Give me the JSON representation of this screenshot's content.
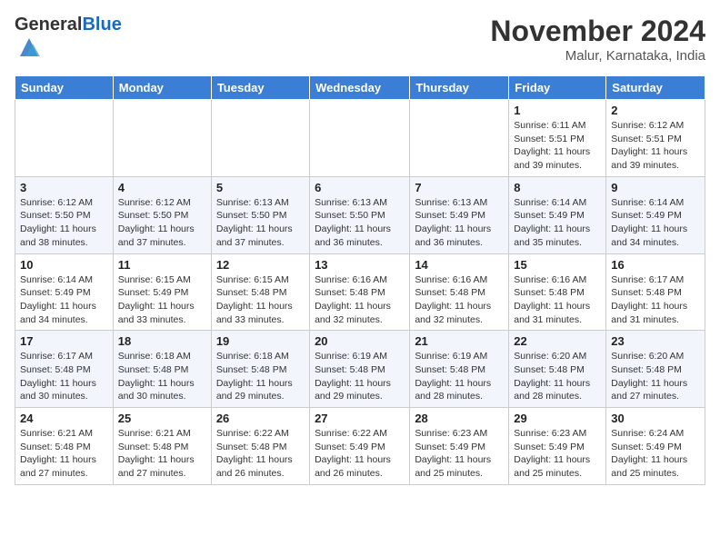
{
  "header": {
    "logo_general": "General",
    "logo_blue": "Blue",
    "month_title": "November 2024",
    "location": "Malur, Karnataka, India"
  },
  "weekdays": [
    "Sunday",
    "Monday",
    "Tuesday",
    "Wednesday",
    "Thursday",
    "Friday",
    "Saturday"
  ],
  "weeks": [
    [
      {
        "day": "",
        "info": ""
      },
      {
        "day": "",
        "info": ""
      },
      {
        "day": "",
        "info": ""
      },
      {
        "day": "",
        "info": ""
      },
      {
        "day": "",
        "info": ""
      },
      {
        "day": "1",
        "info": "Sunrise: 6:11 AM\nSunset: 5:51 PM\nDaylight: 11 hours and 39 minutes."
      },
      {
        "day": "2",
        "info": "Sunrise: 6:12 AM\nSunset: 5:51 PM\nDaylight: 11 hours and 39 minutes."
      }
    ],
    [
      {
        "day": "3",
        "info": "Sunrise: 6:12 AM\nSunset: 5:50 PM\nDaylight: 11 hours and 38 minutes."
      },
      {
        "day": "4",
        "info": "Sunrise: 6:12 AM\nSunset: 5:50 PM\nDaylight: 11 hours and 37 minutes."
      },
      {
        "day": "5",
        "info": "Sunrise: 6:13 AM\nSunset: 5:50 PM\nDaylight: 11 hours and 37 minutes."
      },
      {
        "day": "6",
        "info": "Sunrise: 6:13 AM\nSunset: 5:50 PM\nDaylight: 11 hours and 36 minutes."
      },
      {
        "day": "7",
        "info": "Sunrise: 6:13 AM\nSunset: 5:49 PM\nDaylight: 11 hours and 36 minutes."
      },
      {
        "day": "8",
        "info": "Sunrise: 6:14 AM\nSunset: 5:49 PM\nDaylight: 11 hours and 35 minutes."
      },
      {
        "day": "9",
        "info": "Sunrise: 6:14 AM\nSunset: 5:49 PM\nDaylight: 11 hours and 34 minutes."
      }
    ],
    [
      {
        "day": "10",
        "info": "Sunrise: 6:14 AM\nSunset: 5:49 PM\nDaylight: 11 hours and 34 minutes."
      },
      {
        "day": "11",
        "info": "Sunrise: 6:15 AM\nSunset: 5:49 PM\nDaylight: 11 hours and 33 minutes."
      },
      {
        "day": "12",
        "info": "Sunrise: 6:15 AM\nSunset: 5:48 PM\nDaylight: 11 hours and 33 minutes."
      },
      {
        "day": "13",
        "info": "Sunrise: 6:16 AM\nSunset: 5:48 PM\nDaylight: 11 hours and 32 minutes."
      },
      {
        "day": "14",
        "info": "Sunrise: 6:16 AM\nSunset: 5:48 PM\nDaylight: 11 hours and 32 minutes."
      },
      {
        "day": "15",
        "info": "Sunrise: 6:16 AM\nSunset: 5:48 PM\nDaylight: 11 hours and 31 minutes."
      },
      {
        "day": "16",
        "info": "Sunrise: 6:17 AM\nSunset: 5:48 PM\nDaylight: 11 hours and 31 minutes."
      }
    ],
    [
      {
        "day": "17",
        "info": "Sunrise: 6:17 AM\nSunset: 5:48 PM\nDaylight: 11 hours and 30 minutes."
      },
      {
        "day": "18",
        "info": "Sunrise: 6:18 AM\nSunset: 5:48 PM\nDaylight: 11 hours and 30 minutes."
      },
      {
        "day": "19",
        "info": "Sunrise: 6:18 AM\nSunset: 5:48 PM\nDaylight: 11 hours and 29 minutes."
      },
      {
        "day": "20",
        "info": "Sunrise: 6:19 AM\nSunset: 5:48 PM\nDaylight: 11 hours and 29 minutes."
      },
      {
        "day": "21",
        "info": "Sunrise: 6:19 AM\nSunset: 5:48 PM\nDaylight: 11 hours and 28 minutes."
      },
      {
        "day": "22",
        "info": "Sunrise: 6:20 AM\nSunset: 5:48 PM\nDaylight: 11 hours and 28 minutes."
      },
      {
        "day": "23",
        "info": "Sunrise: 6:20 AM\nSunset: 5:48 PM\nDaylight: 11 hours and 27 minutes."
      }
    ],
    [
      {
        "day": "24",
        "info": "Sunrise: 6:21 AM\nSunset: 5:48 PM\nDaylight: 11 hours and 27 minutes."
      },
      {
        "day": "25",
        "info": "Sunrise: 6:21 AM\nSunset: 5:48 PM\nDaylight: 11 hours and 27 minutes."
      },
      {
        "day": "26",
        "info": "Sunrise: 6:22 AM\nSunset: 5:48 PM\nDaylight: 11 hours and 26 minutes."
      },
      {
        "day": "27",
        "info": "Sunrise: 6:22 AM\nSunset: 5:49 PM\nDaylight: 11 hours and 26 minutes."
      },
      {
        "day": "28",
        "info": "Sunrise: 6:23 AM\nSunset: 5:49 PM\nDaylight: 11 hours and 25 minutes."
      },
      {
        "day": "29",
        "info": "Sunrise: 6:23 AM\nSunset: 5:49 PM\nDaylight: 11 hours and 25 minutes."
      },
      {
        "day": "30",
        "info": "Sunrise: 6:24 AM\nSunset: 5:49 PM\nDaylight: 11 hours and 25 minutes."
      }
    ]
  ]
}
